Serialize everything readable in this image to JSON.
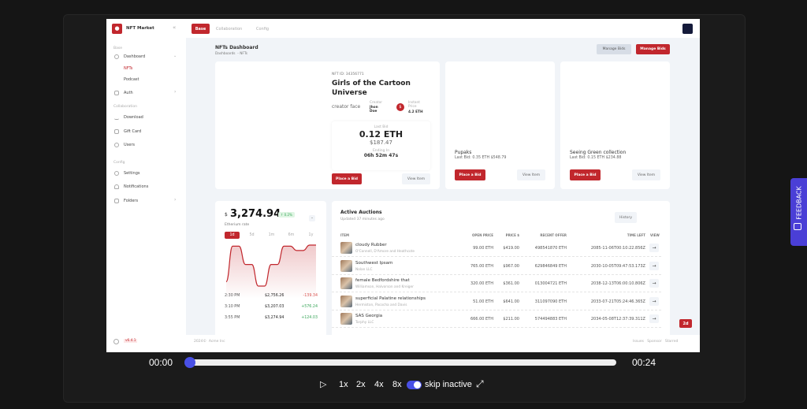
{
  "app": {
    "brand": "NFT Market",
    "version": "v6.4.1"
  },
  "topnav": {
    "tabs": [
      {
        "label": "Base",
        "active": true
      },
      {
        "label": "Collaboration"
      },
      {
        "label": "Config"
      }
    ]
  },
  "sidebar": {
    "sections": [
      {
        "title": "Base",
        "items": [
          {
            "label": "Dashboard",
            "icon": "dashboard-icon",
            "sub": [
              {
                "label": "NFTs",
                "active": true
              },
              {
                "label": "Podcast"
              }
            ]
          },
          {
            "label": "Auth",
            "icon": "lock-icon"
          }
        ]
      },
      {
        "title": "Collaboration",
        "items": [
          {
            "label": "Download",
            "icon": "download-icon"
          },
          {
            "label": "Gift Card",
            "icon": "gift-icon"
          },
          {
            "label": "Users",
            "icon": "users-icon"
          }
        ]
      },
      {
        "title": "Config",
        "items": [
          {
            "label": "Settings",
            "icon": "gear-icon"
          },
          {
            "label": "Notifications",
            "icon": "bell-icon"
          },
          {
            "label": "Folders",
            "icon": "folder-icon"
          }
        ]
      }
    ]
  },
  "page": {
    "title": "NFTs Dashboard",
    "breadcrumb": [
      "Dashboards",
      "- NFTs"
    ],
    "manage_bids_secondary": "Manage Bids",
    "manage_bids_primary": "Manage Bids"
  },
  "featured": {
    "nft_id": "NFT ID: 34356771",
    "title": "Girls of the Cartoon Universe",
    "creator_img_alt": "creator face",
    "creator_label": "Creator",
    "creator_name": "Jhon Doe",
    "instant_label": "Instant Price",
    "instant_price": "4.2 ETH",
    "last_bid_label": "Last Bid",
    "last_bid": "0.12 ETH",
    "last_bid_usd": "$187.47",
    "ending_label": "Ending In",
    "ending": "06h 52m 47s",
    "place_bid": "Place a Bid",
    "view_item": "View Item"
  },
  "collections": [
    {
      "title": "Pupaks",
      "last_bid": "Last Bid: 0.35 ETH $548.79",
      "place_bid": "Place a Bid",
      "view_item": "View Item"
    },
    {
      "title": "Seeing Green collection",
      "last_bid": "Last Bid: 0.15 ETH $234.88",
      "place_bid": "Place a Bid",
      "view_item": "View Item"
    }
  ],
  "eth": {
    "currency": "$",
    "price": "3,274.94",
    "change": "↑ 0.2%",
    "label": "Etherium rate",
    "ranges": [
      "1d",
      "5d",
      "1m",
      "6m",
      "1y"
    ],
    "active_range": "1d",
    "accent": "#c1272d",
    "chart_data": {
      "type": "area",
      "values": [
        2900,
        3230,
        3230,
        3060,
        3060,
        2860,
        2860,
        3060,
        3060,
        3230,
        3230,
        3190,
        3190,
        3240,
        3240
      ]
    },
    "history": [
      {
        "time": "2:30 PM",
        "price": "$2,756.26",
        "delta": "-139.34"
      },
      {
        "time": "3:10 PM",
        "price": "$3,207.03",
        "delta": "+576.24"
      },
      {
        "time": "3:55 PM",
        "price": "$3,274.94",
        "delta": "+124.03"
      }
    ]
  },
  "auctions": {
    "title": "Active Auctions",
    "updated": "Updated 37 minutes ago",
    "history_btn": "History",
    "columns": [
      "ITEM",
      "OPEN PRICE",
      "PRICE $",
      "RECENT OFFER",
      "TIME LEFT",
      "VIEW"
    ],
    "rows": [
      {
        "name": "cloudy Rubber",
        "company": "O'Connell, D'Amore and Heathcote",
        "open": "99.00 ETH",
        "price": "$419.00",
        "offer": "498541870 ETH",
        "time": "2085-11-06T00:10:22.856Z"
      },
      {
        "name": "Southwest Ipsam",
        "company": "Nolan LLC",
        "open": "765.00 ETH",
        "price": "$967.00",
        "offer": "629846849 ETH",
        "time": "2030-10-05T09:47:53.173Z"
      },
      {
        "name": "female Bedfordshire that",
        "company": "Williamson, Halvorson and Kreiger",
        "open": "320.00 ETH",
        "price": "$361.00",
        "offer": "013004721 ETH",
        "time": "2038-12-13T06:00:10.806Z"
      },
      {
        "name": "superficial Palatine relationships",
        "company": "Hermiston, Pacocha and Davis",
        "open": "51.00 ETH",
        "price": "$641.00",
        "offer": "311097090 ETH",
        "time": "2033-07-21T05:24:46.365Z"
      },
      {
        "name": "SAS Georgia",
        "company": "Torphy LLC",
        "open": "666.00 ETH",
        "price": "$211.00",
        "offer": "574494883 ETH",
        "time": "2034-05-08T12:37:39.311Z"
      }
    ]
  },
  "badge_2d": "2d",
  "footer": {
    "copyright": "2024©",
    "company": "Acme Inc",
    "links": [
      "Issues",
      "Sponsor",
      "Starred"
    ]
  },
  "player": {
    "current": "00:00",
    "total": "00:24",
    "progress": 0,
    "speeds": [
      "1x",
      "2x",
      "4x",
      "8x"
    ],
    "skip_label": "skip inactive",
    "skip_on": true,
    "accent": "#4950e6"
  },
  "feedback": {
    "label": "FEEDBACK"
  }
}
